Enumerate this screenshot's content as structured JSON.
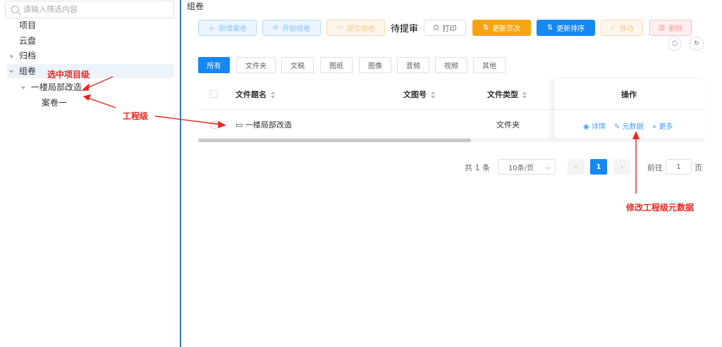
{
  "sidebar": {
    "search_placeholder": "请输入筛选内容",
    "tree": [
      "项目",
      "云盘",
      "归档",
      "组卷",
      "一楼局部改造",
      "案卷一"
    ]
  },
  "annotations": {
    "select_project": "选中项目级",
    "engineering": "工程级",
    "modify_meta": "修改工程级元数据",
    "color": "#e8271f"
  },
  "main": {
    "breadcrumb": "组卷",
    "toolbar": {
      "add": "新增案卷",
      "start": "开始组卷",
      "submit": "提交组卷",
      "status": "待提审",
      "print": "打印",
      "update_page": "更新页次",
      "update_sort": "更新排序",
      "move": "移动",
      "delete": "删除"
    },
    "filter_tabs": [
      "所有",
      "文件夹",
      "文稿",
      "图纸",
      "图像",
      "音频",
      "视频",
      "其他"
    ],
    "table": {
      "headers": [
        "文件题名",
        "文图号",
        "文件类型",
        "操作"
      ],
      "rows": [
        {
          "title": "一楼局部改造",
          "type": "文件夹"
        }
      ],
      "ops": [
        "详情",
        "元数据",
        "更多"
      ]
    },
    "pagination": {
      "total": "共 1 条",
      "page_size": "10条/页",
      "current": "1",
      "goto_label": "前往",
      "goto_value": "1",
      "page_unit": "页"
    }
  }
}
